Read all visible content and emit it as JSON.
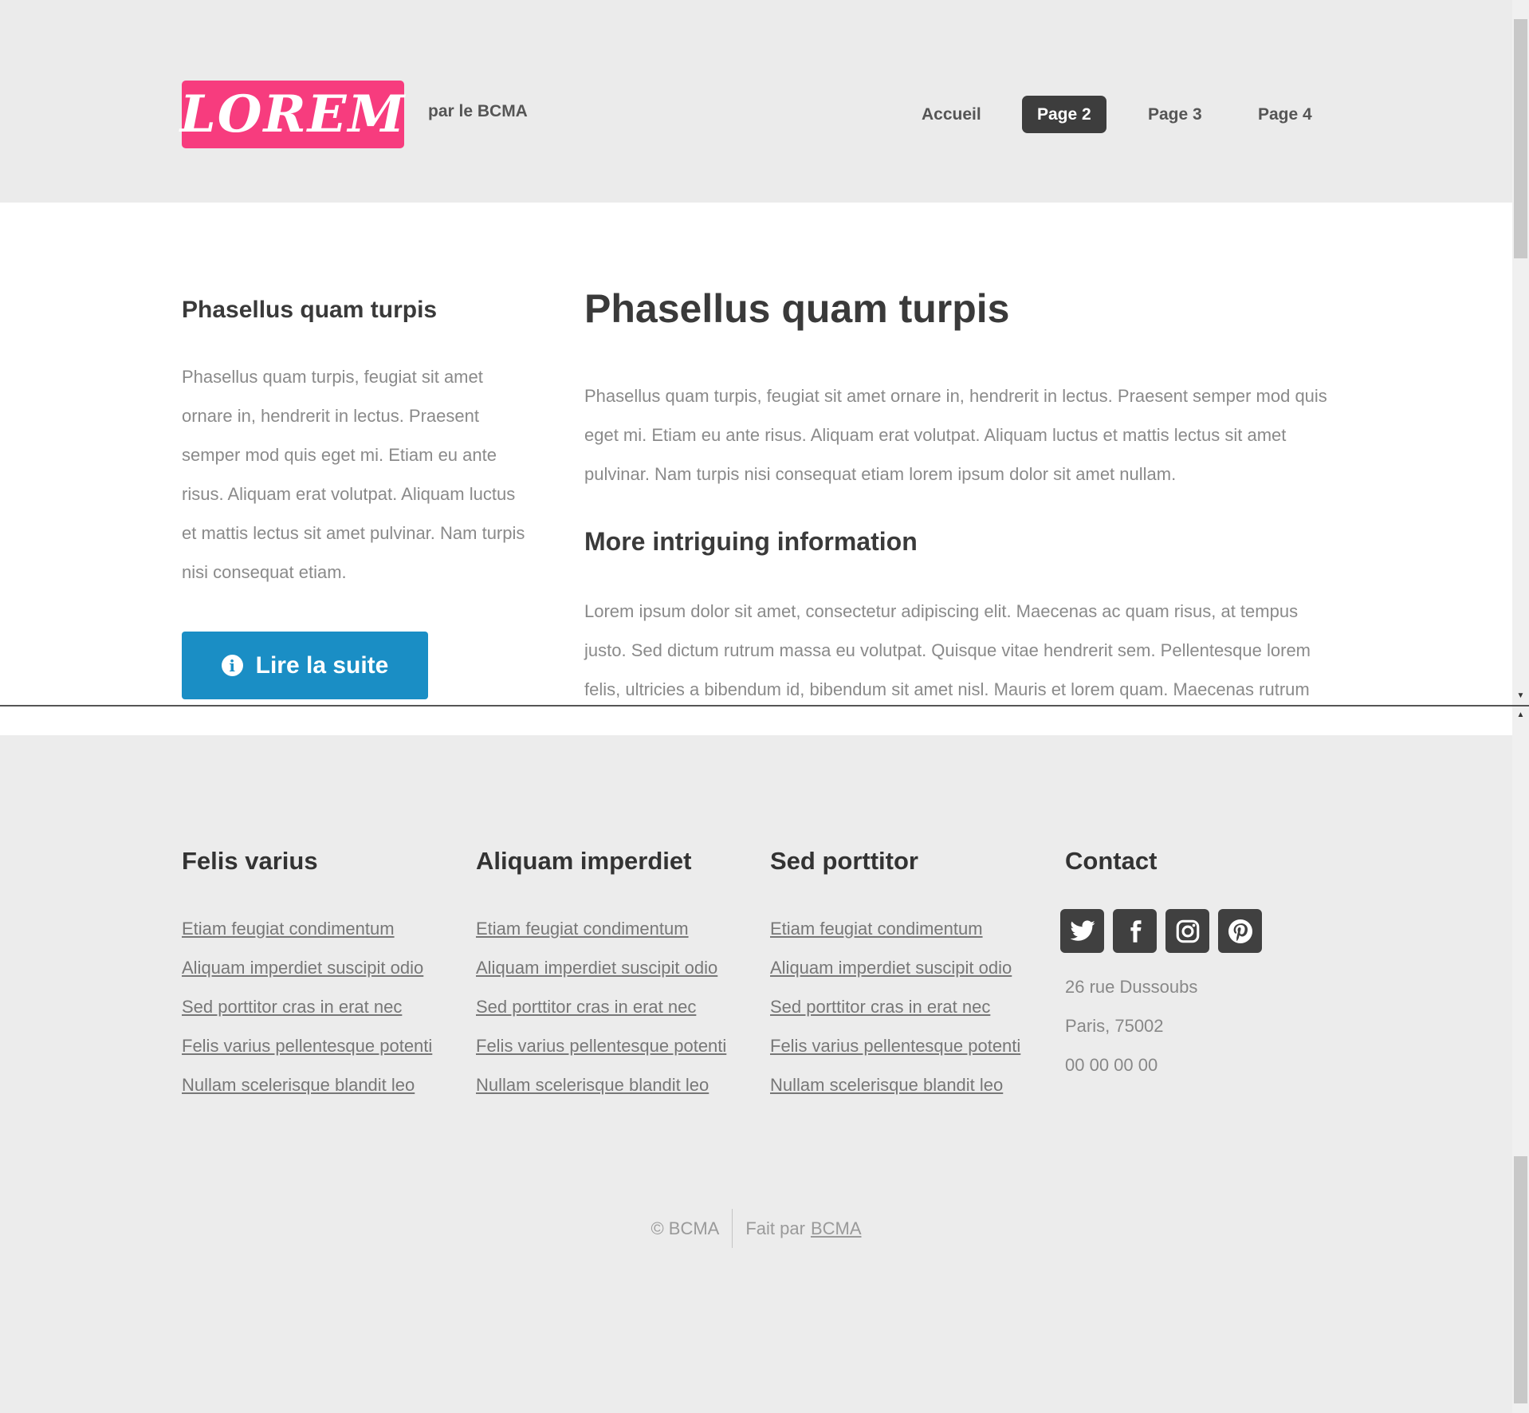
{
  "header": {
    "logo": "LOREM",
    "tagline": "par le BCMA",
    "nav": [
      {
        "label": "Accueil",
        "active": false
      },
      {
        "label": "Page 2",
        "active": true
      },
      {
        "label": "Page 3",
        "active": false
      },
      {
        "label": "Page 4",
        "active": false
      }
    ]
  },
  "sidebar": {
    "title": "Phasellus quam turpis",
    "text": "Phasellus quam turpis, feugiat sit amet ornare in, hendrerit in lectus. Praesent semper mod quis eget mi. Etiam eu ante risus. Aliquam erat volutpat. Aliquam luctus et mattis lectus sit amet pulvinar. Nam turpis nisi consequat etiam.",
    "button_label": "Lire la suite",
    "button_icon": "info-icon"
  },
  "main": {
    "title": "Phasellus quam turpis",
    "paragraph": "Phasellus quam turpis, feugiat sit amet ornare in, hendrerit in lectus. Praesent semper mod quis eget mi. Etiam eu ante risus. Aliquam erat volutpat. Aliquam luctus et mattis lectus sit amet pulvinar. Nam turpis nisi consequat etiam lorem ipsum dolor sit amet nullam.",
    "subtitle": "More intriguing information",
    "subparagraph": "Lorem ipsum dolor sit amet, consectetur adipiscing elit. Maecenas ac quam risus, at tempus justo. Sed dictum rutrum massa eu volutpat. Quisque vitae hendrerit sem. Pellentesque lorem felis, ultricies a bibendum id, bibendum sit amet nisl. Mauris et lorem quam. Maecenas rutrum"
  },
  "footer": {
    "columns": [
      {
        "title": "Felis varius",
        "links": [
          "Etiam feugiat condimentum",
          "Aliquam imperdiet suscipit odio",
          "Sed porttitor cras in erat nec",
          "Felis varius pellentesque potenti",
          "Nullam scelerisque blandit leo"
        ]
      },
      {
        "title": "Aliquam imperdiet",
        "links": [
          "Etiam feugiat condimentum",
          "Aliquam imperdiet suscipit odio",
          "Sed porttitor cras in erat nec",
          "Felis varius pellentesque potenti",
          "Nullam scelerisque blandit leo"
        ]
      },
      {
        "title": "Sed porttitor",
        "links": [
          "Etiam feugiat condimentum",
          "Aliquam imperdiet suscipit odio",
          "Sed porttitor cras in erat nec",
          "Felis varius pellentesque potenti",
          "Nullam scelerisque blandit leo"
        ]
      }
    ],
    "contact": {
      "title": "Contact",
      "social": [
        "twitter-icon",
        "facebook-icon",
        "instagram-icon",
        "pinterest-icon"
      ],
      "address_line1": "26 rue Dussoubs",
      "address_line2": "Paris, 75002",
      "phone": "00 00 00 00"
    },
    "copyright": "© BCMA",
    "made_by_prefix": "Fait par",
    "made_by_link": "BCMA"
  },
  "colors": {
    "logo_bg": "#f73c7e",
    "button_bg": "#1a8ec5",
    "nav_active_bg": "#3d3d3d",
    "social_bg": "#404040"
  }
}
